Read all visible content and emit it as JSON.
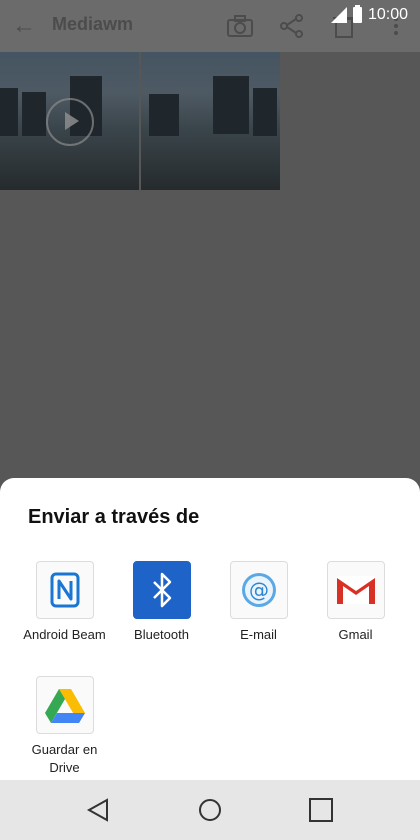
{
  "status": {
    "time": "10:00"
  },
  "app_bar": {
    "title": "Mediawm"
  },
  "share_sheet": {
    "title": "Enviar a través de",
    "options": [
      {
        "label": "Android Beam",
        "icon": "nfc-icon"
      },
      {
        "label": "Bluetooth",
        "icon": "bluetooth-icon"
      },
      {
        "label": "E-mail",
        "icon": "email-icon"
      },
      {
        "label": "Gmail",
        "icon": "gmail-icon"
      },
      {
        "label": "Guardar en Drive",
        "icon": "drive-icon"
      }
    ]
  },
  "colors": {
    "bluetooth": "#1e63c7",
    "gmail_red": "#d93025",
    "email_blue": "#5aa9e6"
  }
}
